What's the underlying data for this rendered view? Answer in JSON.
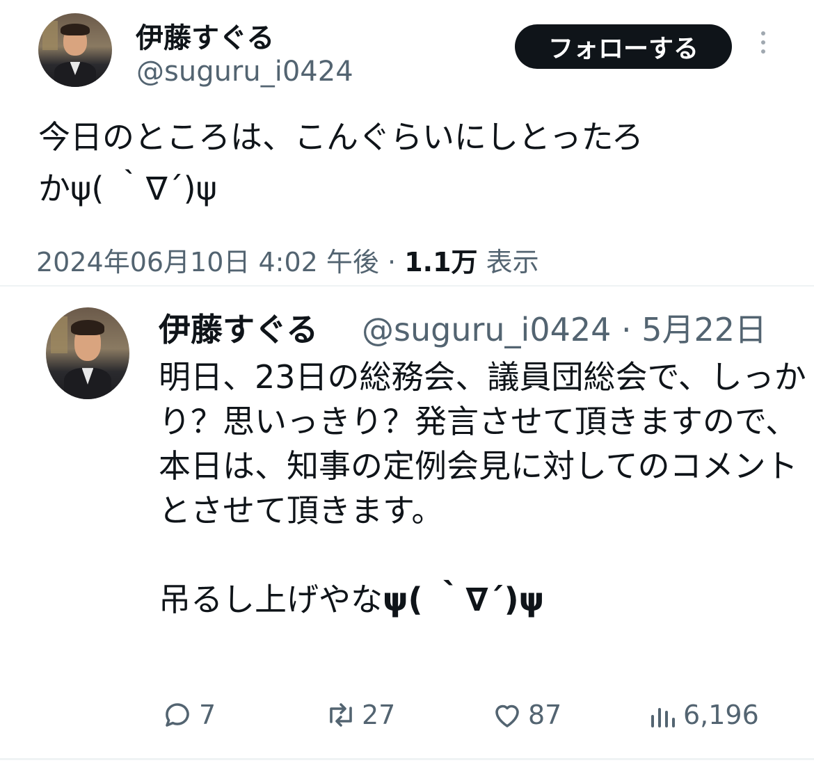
{
  "tweet": {
    "author_name": "伊藤すぐる",
    "author_handle": "@suguru_i0424",
    "follow_label": "フォローする",
    "text": "今日のところは、こんぐらいにしとったろ\nかψ( ｀∇´)ψ",
    "date": "2024年06月10日 4:02 午後",
    "separator": "·",
    "views_count": "1.1万",
    "views_label": "表示"
  },
  "quoted_tweet": {
    "author_name": "伊藤すぐる",
    "author_handle_date": "@suguru_i0424 · 5月22日",
    "text": "明日、23日の総務会、議員団総会で、しっかり？思いっきり？発言させて頂きますので、本日は、知事の定例会見に対してのコメントとさせて頂きます。\n\n吊るし上げやな",
    "text_tail": "ψ( ｀∇´)ψ",
    "actions": {
      "replies": "7",
      "retweets": "27",
      "likes": "87",
      "views": "6,196"
    }
  },
  "icons": [
    "reply-icon",
    "retweet-icon",
    "like-icon",
    "views-icon",
    "more-icon"
  ]
}
